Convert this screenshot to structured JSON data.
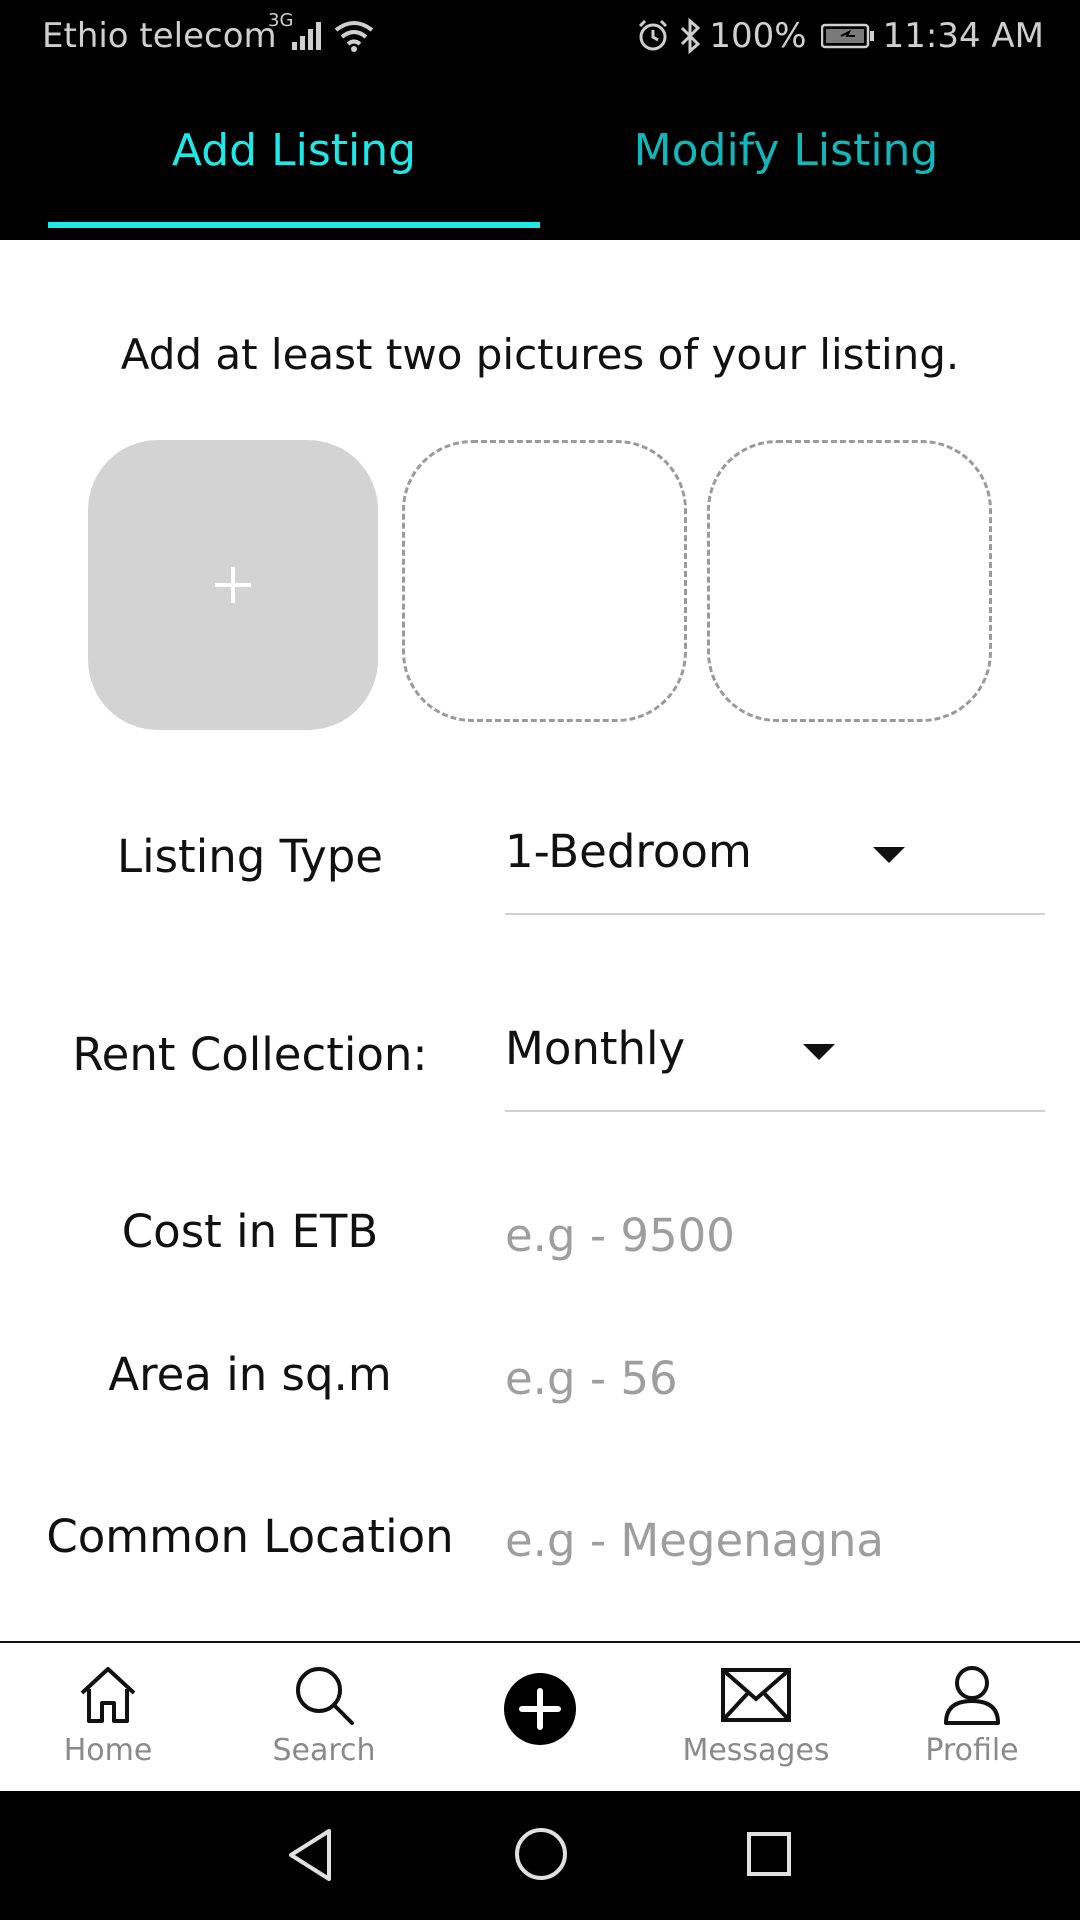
{
  "status_bar": {
    "carrier": "Ethio telecom",
    "network": "3G",
    "battery": "100%",
    "time": "11:34 AM"
  },
  "tabs": [
    {
      "label": "Add Listing",
      "active": true
    },
    {
      "label": "Modify Listing",
      "active": false
    }
  ],
  "instructions": "Add at least two pictures of your listing.",
  "photos": {
    "add_symbol": "+"
  },
  "form": {
    "listing_type": {
      "label": "Listing Type",
      "value": "1-Bedroom"
    },
    "rent_collection": {
      "label": "Rent Collection:",
      "value": "Monthly"
    },
    "cost": {
      "label": "Cost in ETB",
      "placeholder": "e.g - 9500"
    },
    "area": {
      "label": "Area in sq.m",
      "placeholder": "e.g - 56"
    },
    "location": {
      "label": "Common Location",
      "placeholder": "e.g - Megenagna"
    }
  },
  "bottom_nav": [
    {
      "label": "Home",
      "icon": "home-icon"
    },
    {
      "label": "Search",
      "icon": "search-icon"
    },
    {
      "label": "",
      "icon": "add-circle-icon"
    },
    {
      "label": "Messages",
      "icon": "mail-icon"
    },
    {
      "label": "Profile",
      "icon": "profile-icon"
    }
  ],
  "colors": {
    "accent": "#1de9e9",
    "accent_dim": "#11b8bb",
    "placeholder": "#9e9e9e"
  }
}
